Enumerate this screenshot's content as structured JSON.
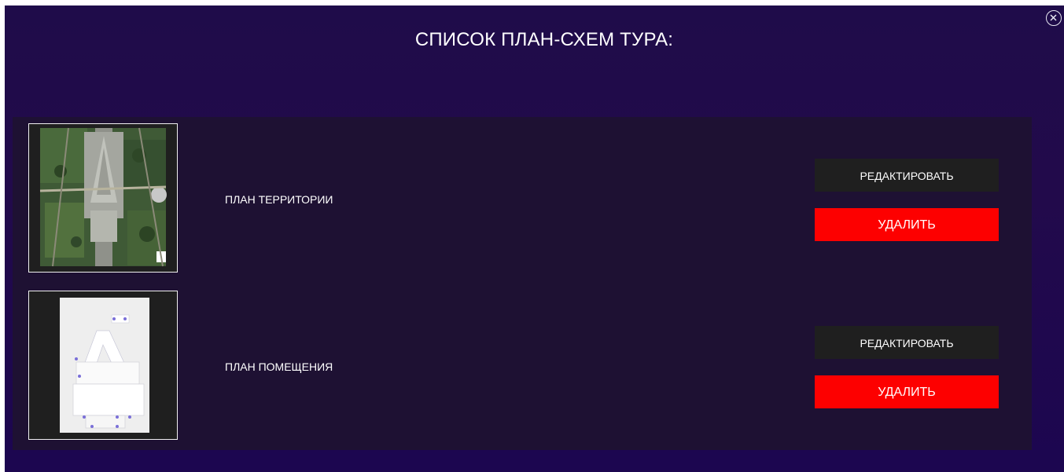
{
  "dialog": {
    "title": "СПИСОК ПЛАН-СХЕМ ТУРА:",
    "close_icon": "close-circle-icon"
  },
  "plans": [
    {
      "name": "ПЛАН ТЕРРИТОРИИ",
      "thumbnail": "satellite-map-thumbnail",
      "edit_label": "РЕДАКТИРОВАТЬ",
      "delete_label": "УДАЛИТЬ"
    },
    {
      "name": "ПЛАН ПОМЕЩЕНИЯ",
      "thumbnail": "floor-plan-thumbnail",
      "edit_label": "РЕДАКТИРОВАТЬ",
      "delete_label": "УДАЛИТЬ"
    }
  ],
  "colors": {
    "background": "#220a4b",
    "panel": "#1e1133",
    "edit_button": "#1f1f1f",
    "delete_button": "#fd0000"
  }
}
